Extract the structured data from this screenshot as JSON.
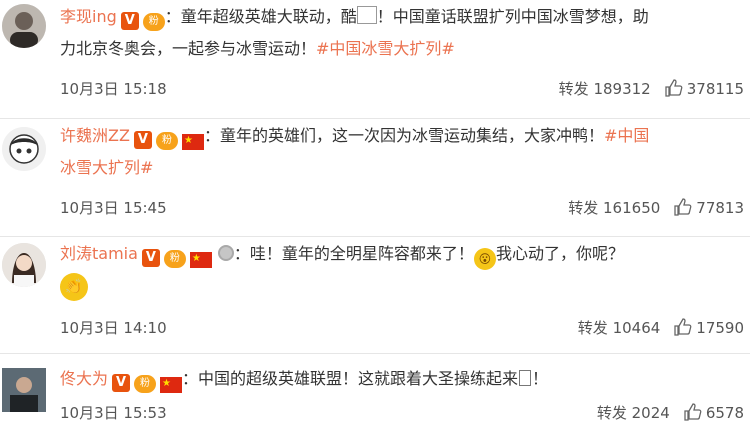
{
  "comments": [
    {
      "user": "李现ing",
      "badges": {
        "verified": "V",
        "fan": "粉"
      },
      "text_line1": "：童年超级英雄大联动，酷",
      "text_line1b": "！中国童话联盟扩列中国冰雪梦想，助",
      "text_line2": "力北京冬奥会，一起参与冰雪运动！",
      "hashtag": "#中国冰雪大扩列#",
      "time": "10月3日 15:18",
      "repost_label": "转发",
      "repost_count": "189312",
      "like_count": "378115"
    },
    {
      "user": "许魏洲ZZ",
      "badges": {
        "verified": "V",
        "fan": "粉",
        "flag": "★"
      },
      "text_line1": "：童年的英雄们，这一次因为冰雪运动集结，大家冲鸭！",
      "hashtag_a": "#中国",
      "hashtag_b": "冰雪大扩列#",
      "time": "10月3日 15:45",
      "repost_label": "转发",
      "repost_count": "161650",
      "like_count": "77813"
    },
    {
      "user": "刘涛tamia",
      "badges": {
        "verified": "V",
        "fan": "粉",
        "flag": "★"
      },
      "text_line1": "：哇！童年的全明星阵容都来了！",
      "text_line1b": "我心动了，你呢？",
      "time": "10月3日 14:10",
      "repost_label": "转发",
      "repost_count": "10464",
      "like_count": "17590"
    },
    {
      "user": "佟大为",
      "badges": {
        "verified": "V",
        "fan": "粉",
        "flag": "★"
      },
      "text_line1": "：中国的超级英雄联盟！这就跟着大圣操练起来",
      "text_line1b": "！",
      "time": "10月3日 15:53",
      "repost_label": "转发",
      "repost_count": "2024",
      "like_count": "6578"
    }
  ],
  "colors": {
    "accent": "#eb7350",
    "verified": "#e8530e",
    "text": "#333333",
    "meta": "#555555"
  }
}
